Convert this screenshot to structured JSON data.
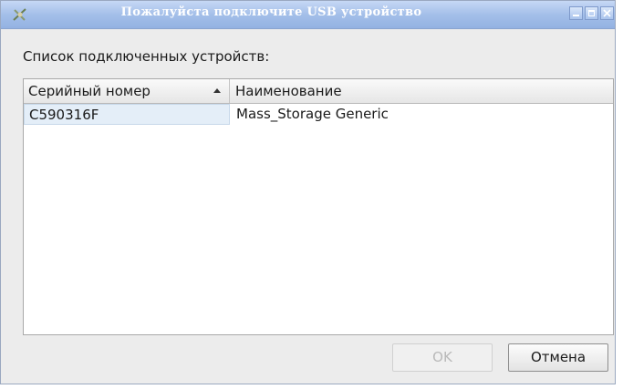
{
  "window": {
    "title": "Пожалуйста подключите USB устройство",
    "icon": "usb-app-icon",
    "controls": [
      "minimize-icon",
      "maximize-icon",
      "close-icon"
    ]
  },
  "main": {
    "list_label": "Список подключенных устройств:",
    "table": {
      "columns": [
        {
          "label": "Серийный номер",
          "sort": "ascending"
        },
        {
          "label": "Наименование"
        }
      ],
      "rows": [
        {
          "serial": "C590316F",
          "name": "Mass_Storage Generic"
        }
      ]
    }
  },
  "buttons": {
    "ok_label": "OK",
    "ok_enabled": false,
    "cancel_label": "Отмена"
  },
  "colors": {
    "titlebar": "#a4bfe9",
    "title_text": "#ffffff",
    "selection": "#e4eef8"
  }
}
